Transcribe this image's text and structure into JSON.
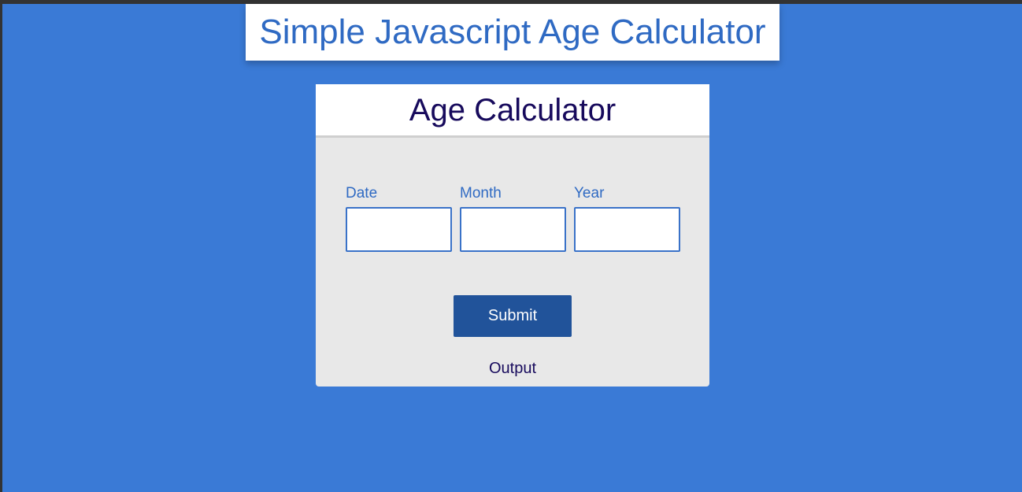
{
  "header": {
    "title": "Simple Javascript Age Calculator"
  },
  "calculator": {
    "title": "Age Calculator",
    "fields": [
      {
        "label": "Date",
        "value": "",
        "placeholder": ""
      },
      {
        "label": "Month",
        "value": "",
        "placeholder": ""
      },
      {
        "label": "Year",
        "value": "",
        "placeholder": ""
      }
    ],
    "submit_label": "Submit",
    "output_text": "Output"
  },
  "colors": {
    "background": "#3a7ad6",
    "title_text": "#2f6ac3",
    "card_title_text": "#170a5c",
    "card_background": "#e8e8e8",
    "button_background": "#21539a"
  }
}
